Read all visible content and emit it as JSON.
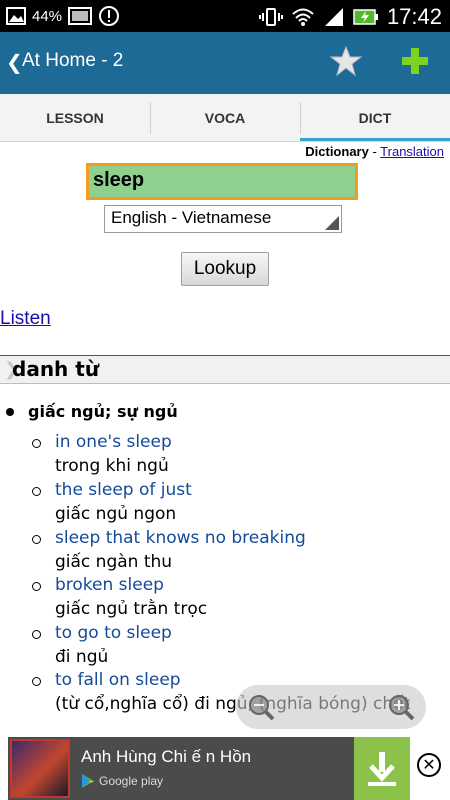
{
  "status_bar": {
    "battery_percent": "44%",
    "time": "17:42",
    "icons": [
      "gallery-icon",
      "battery-icon",
      "image-icon",
      "alert-icon",
      "vibrate-icon",
      "wifi-icon",
      "signal-icon",
      "charging-battery-icon"
    ]
  },
  "action_bar": {
    "back_glyph": "❮",
    "title": "At Home - 2",
    "favorite_icon": "star-icon",
    "add_icon": "plus-icon",
    "colors": {
      "bar": "#1c6a95",
      "plus": "#7ed321"
    }
  },
  "tabs": [
    {
      "label": "LESSON",
      "active": false
    },
    {
      "label": "VOCA",
      "active": false
    },
    {
      "label": "DICT",
      "active": true
    }
  ],
  "dictionary": {
    "mode_current": "Dictionary",
    "mode_separator": " - ",
    "mode_link": "Translation",
    "query": "sleep",
    "language": "English - Vietnamese",
    "lookup_label": "Lookup",
    "listen_label": "Listen",
    "part_of_speech": "danh từ",
    "meaning": "giấc ngủ; sự ngủ",
    "examples": [
      {
        "en": "in one's sleep",
        "vi": "trong khi ngủ"
      },
      {
        "en": "the sleep of just",
        "vi": "giấc ngủ ngon"
      },
      {
        "en": "sleep that knows no breaking",
        "vi": "giấc ngàn thu"
      },
      {
        "en": "broken sleep",
        "vi": "giấc ngủ trằn trọc"
      },
      {
        "en": "to go to sleep",
        "vi": "đi ngủ"
      },
      {
        "en": "to fall on sleep",
        "vi": "(từ cổ,nghĩa cổ) đi ngủ; (nghĩa bóng) chết"
      }
    ],
    "colors": {
      "query_bg": "#8fd08f",
      "query_border": "#f39b1f",
      "example_en": "#144a9a"
    }
  },
  "zoom": {
    "out_icon": "zoom-out-icon",
    "in_icon": "zoom-in-icon"
  },
  "ad": {
    "title": "Anh Hùng Chi ế n Hồn",
    "store_label": "Google play",
    "download_icon": "download-icon",
    "close_glyph": "✕"
  }
}
